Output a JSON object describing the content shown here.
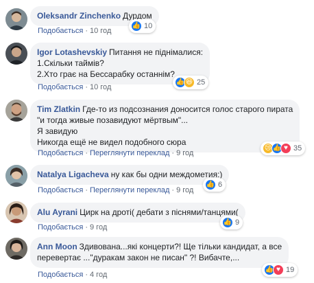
{
  "ui": {
    "like_label": "Подобається",
    "translate_label": "Переглянути переклад",
    "separator": "·"
  },
  "colors": {
    "author": "#385898",
    "bubble": "#f2f3f5",
    "meta_text": "#606770",
    "like": "#1877f2",
    "love": "#f33e58",
    "haha": "#f7b928"
  },
  "comments": [
    {
      "author": "Oleksandr Zinchenko",
      "lines": [
        "Дурдом"
      ],
      "time": "10 год",
      "reactions": {
        "icons": [
          "like-icon"
        ],
        "count": "10"
      }
    },
    {
      "author": "Igor Lotashevskiy",
      "lines": [
        "Питання не піднімалися:",
        "1.Скільки таймів?",
        "2.Хто грає на Бессарабку останнім?"
      ],
      "time": "10 год",
      "reactions": {
        "icons": [
          "like-icon",
          "haha-icon"
        ],
        "count": "25"
      }
    },
    {
      "author": "Tim Zlatkin",
      "lines": [
        "Где-то из подсознания доносится голос старого пирата",
        "\"и тогда живые позавидуют мёртвым\"...",
        "Я завидую",
        "Никогда ещё не видел подобного сюра"
      ],
      "time": "9 год",
      "reactions": {
        "icons": [
          "sad-icon",
          "like-icon",
          "love-icon"
        ],
        "count": "35"
      }
    },
    {
      "author": "Natalya Ligacheva",
      "lines": [
        "ну как бы одни междометия:)"
      ],
      "time": "9 год",
      "reactions": {
        "icons": [
          "like-icon"
        ],
        "count": "6"
      }
    },
    {
      "author": "Alu Ayrani",
      "lines": [
        "Цирк на дроті( дебати з піснями/танцями("
      ],
      "time": "9 год",
      "reactions": {
        "icons": [
          "like-icon"
        ],
        "count": "9"
      }
    },
    {
      "author": "Ann Moon",
      "lines": [
        "Здивована...які концерти?! Ще тільки кандидат, а все",
        "перевертає ...\"дуракам закон не писан\" ?! Вибачте,..."
      ],
      "time": "4 год",
      "reactions": {
        "icons": [
          "like-icon",
          "love-icon"
        ],
        "count": "19"
      }
    }
  ]
}
